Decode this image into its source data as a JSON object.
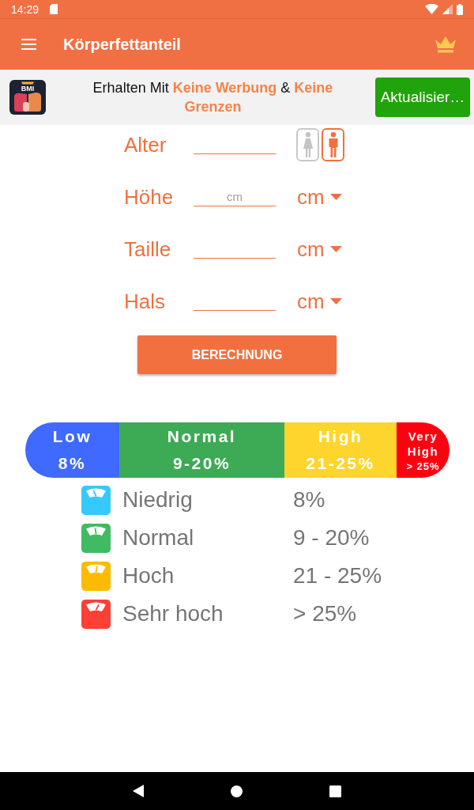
{
  "status_bar": {
    "time": "14:29"
  },
  "app_bar": {
    "title": "Körperfettanteil"
  },
  "promo": {
    "icon_label": "BMI",
    "text": "Erhalten Mit **Keine Werbung** & **Keine Grenzen**",
    "button": "Aktualisier…"
  },
  "form": {
    "fields": [
      {
        "label": "Alter",
        "gender": [
          {
            "kind": "female",
            "selected": false
          },
          {
            "kind": "male",
            "selected": true
          }
        ]
      },
      {
        "label": "Höhe",
        "placeholder": "cm",
        "unit": "cm"
      },
      {
        "label": "Taille",
        "unit": "cm"
      },
      {
        "label": "Hals",
        "unit": "cm"
      }
    ],
    "button": "BERECHNUNG"
  },
  "scale_bar": {
    "segments": [
      {
        "label": "Low",
        "range": "8%",
        "color": "#3f69ff"
      },
      {
        "label": "Normal",
        "range": "9-20%",
        "color": "#3daa56"
      },
      {
        "label": "High",
        "range": "21-25%",
        "color": "#fdd52c"
      },
      {
        "label": "Very High",
        "range": "> 25%",
        "color": "#ff0011"
      }
    ]
  },
  "legend": [
    {
      "label": "Niedrig",
      "value": "8%",
      "color": "#36c9fd"
    },
    {
      "label": "Normal",
      "value": "9 - 20%",
      "color": "#40bb63"
    },
    {
      "label": "Hoch",
      "value": "21 - 25%",
      "color": "#fdbb00"
    },
    {
      "label": "Sehr hoch",
      "value": "> 25%",
      "color": "#fe4034"
    }
  ]
}
